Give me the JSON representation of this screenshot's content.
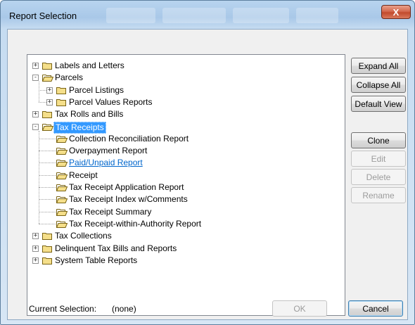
{
  "window": {
    "title": "Report Selection",
    "close_label": "X"
  },
  "tree": [
    {
      "label": "Labels and Letters",
      "level": 0,
      "expander": "+",
      "state": "closed"
    },
    {
      "label": "Parcels",
      "level": 0,
      "expander": "-",
      "state": "open"
    },
    {
      "label": "Parcel Listings",
      "level": 1,
      "expander": "+",
      "state": "closed"
    },
    {
      "label": "Parcel Values Reports",
      "level": 1,
      "expander": "+",
      "state": "closed"
    },
    {
      "label": "Tax Rolls and Bills",
      "level": 0,
      "expander": "+",
      "state": "closed"
    },
    {
      "label": "Tax Receipts",
      "level": 0,
      "expander": "-",
      "state": "open",
      "selected": true
    },
    {
      "label": "Collection Reconciliation Report",
      "level": 1,
      "state": "open"
    },
    {
      "label": "Overpayment Report",
      "level": 1,
      "state": "open"
    },
    {
      "label": "Paid/Unpaid Report",
      "level": 1,
      "state": "open",
      "link": true
    },
    {
      "label": "Receipt",
      "level": 1,
      "state": "open"
    },
    {
      "label": "Tax Receipt Application Report",
      "level": 1,
      "state": "open"
    },
    {
      "label": "Tax Receipt Index w/Comments",
      "level": 1,
      "state": "open"
    },
    {
      "label": "Tax Receipt Summary",
      "level": 1,
      "state": "open"
    },
    {
      "label": "Tax Receipt-within-Authority Report",
      "level": 1,
      "state": "open"
    },
    {
      "label": "Tax Collections",
      "level": 0,
      "expander": "+",
      "state": "closed"
    },
    {
      "label": "Delinquent Tax Bills and Reports",
      "level": 0,
      "expander": "+",
      "state": "closed"
    },
    {
      "label": "System Table Reports",
      "level": 0,
      "expander": "+",
      "state": "closed"
    }
  ],
  "side_buttons": {
    "expand_all": "Expand All",
    "collapse_all": "Collapse All",
    "default_view": "Default View",
    "clone": "Clone",
    "edit": "Edit",
    "delete": "Delete",
    "rename": "Rename"
  },
  "footer": {
    "current_selection_label": "Current Selection:",
    "current_selection_value": "(none)",
    "ok": "OK",
    "cancel": "Cancel"
  },
  "colors": {
    "selection": "#3399ff",
    "link": "#0066cc",
    "folder_fill": "#f5df8a",
    "folder_stroke": "#7a6414"
  },
  "icons": {
    "closed_folder": "folder-icon",
    "open_folder": "folder-open-icon",
    "close": "close-icon"
  }
}
